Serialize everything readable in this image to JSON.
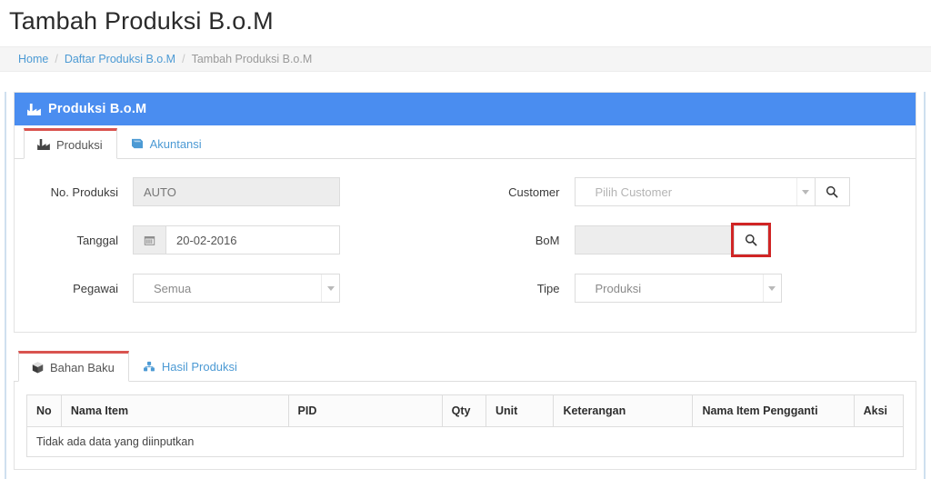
{
  "page": {
    "title": "Tambah Produksi B.o.M"
  },
  "breadcrumb": {
    "items": [
      {
        "label": "Home",
        "current": false
      },
      {
        "label": "Daftar Produksi B.o.M",
        "current": false
      },
      {
        "label": "Tambah Produksi B.o.M",
        "current": true
      }
    ],
    "separator": "/"
  },
  "panel": {
    "heading": "Produksi B.o.M",
    "heading_icon": "factory-icon",
    "header_color": "#4a8df0"
  },
  "top_tabs": [
    {
      "label": "Produksi",
      "icon": "factory-icon",
      "active": true
    },
    {
      "label": "Akuntansi",
      "icon": "book-icon",
      "active": false
    }
  ],
  "form": {
    "left": {
      "no_produksi": {
        "label": "No. Produksi",
        "value": "AUTO",
        "disabled": true
      },
      "tanggal": {
        "label": "Tanggal",
        "value": "20-02-2016",
        "addon_icon": "calendar-icon"
      },
      "pegawai": {
        "label": "Pegawai",
        "value": "Semua",
        "caret_icon": "caret-down-icon"
      }
    },
    "right": {
      "customer": {
        "label": "Customer",
        "value": "Pilih Customer",
        "caret_icon": "caret-down-icon",
        "search_icon": "search-icon"
      },
      "bom": {
        "label": "BoM",
        "value": "",
        "disabled": true,
        "search_icon": "search-icon",
        "highlighted": true,
        "highlight_color": "#d02525"
      },
      "tipe": {
        "label": "Tipe",
        "value": "Produksi",
        "caret_icon": "caret-down-icon"
      }
    }
  },
  "bottom_tabs": [
    {
      "label": "Bahan Baku",
      "icon": "cube-icon",
      "active": true
    },
    {
      "label": "Hasil Produksi",
      "icon": "cubes-icon",
      "active": false
    }
  ],
  "table": {
    "headers": [
      "No",
      "Nama Item",
      "PID",
      "Qty",
      "Unit",
      "Keterangan",
      "Nama Item Pengganti",
      "Aksi"
    ],
    "rows": [],
    "empty_message": "Tidak ada data yang diinputkan"
  }
}
